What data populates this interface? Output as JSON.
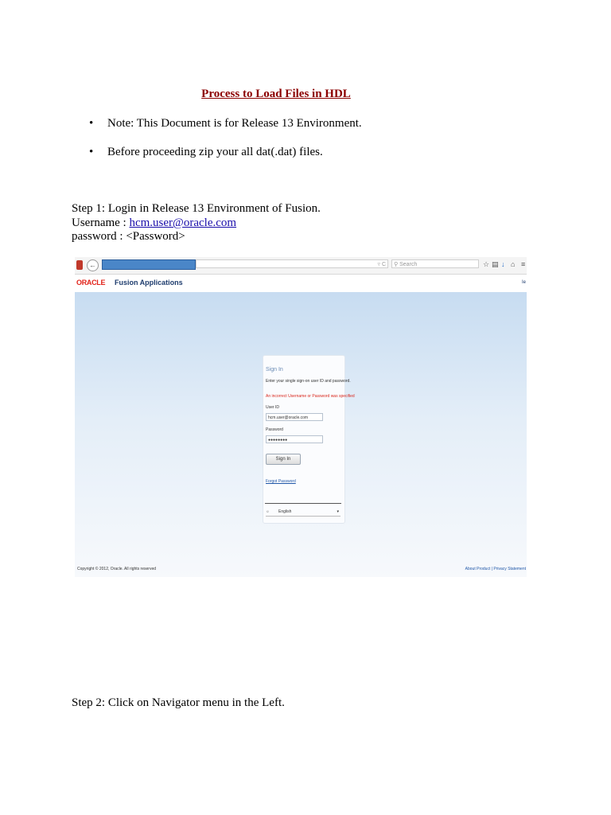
{
  "doc": {
    "title": " Process to Load Files in HDL",
    "bullets": [
      "Note: This Document is for Release 13 Environment.",
      "Before proceeding zip your all dat(.dat) files."
    ],
    "bullet_symbol": "•",
    "step1": "Step 1: Login in Release 13 Environment of Fusion.",
    "username_label": "Username : ",
    "username_value": "hcm.user@oracle.com",
    "password_line": "password : <Password>",
    "step2": "Step 2: Click on Navigator menu in the Left."
  },
  "screenshot": {
    "browser": {
      "search_placeholder": "Search",
      "icons": [
        "firefox-icon",
        "back-icon",
        "star-icon",
        "bookmark-icon",
        "download-icon",
        "home-icon",
        "menu-icon"
      ]
    },
    "header": {
      "logo": "ORACLE",
      "app_name": "Fusion Applications",
      "right_text": "Ie"
    },
    "signin": {
      "title": "Sign In",
      "subtitle": "Enter your single sign-on user ID and password.",
      "error": "An incorrect Username or Password was specified",
      "user_label": "User ID",
      "user_value": "hcm.user@oracle.com",
      "password_label": "Password",
      "password_value": "●●●●●●●●",
      "button": "Sign In",
      "forgot": "Forgot Password",
      "language": "English"
    },
    "copyright": "Copyright © 2012, Oracle. All rights reserved",
    "footer_links": "About Product | Privacy Statement"
  }
}
